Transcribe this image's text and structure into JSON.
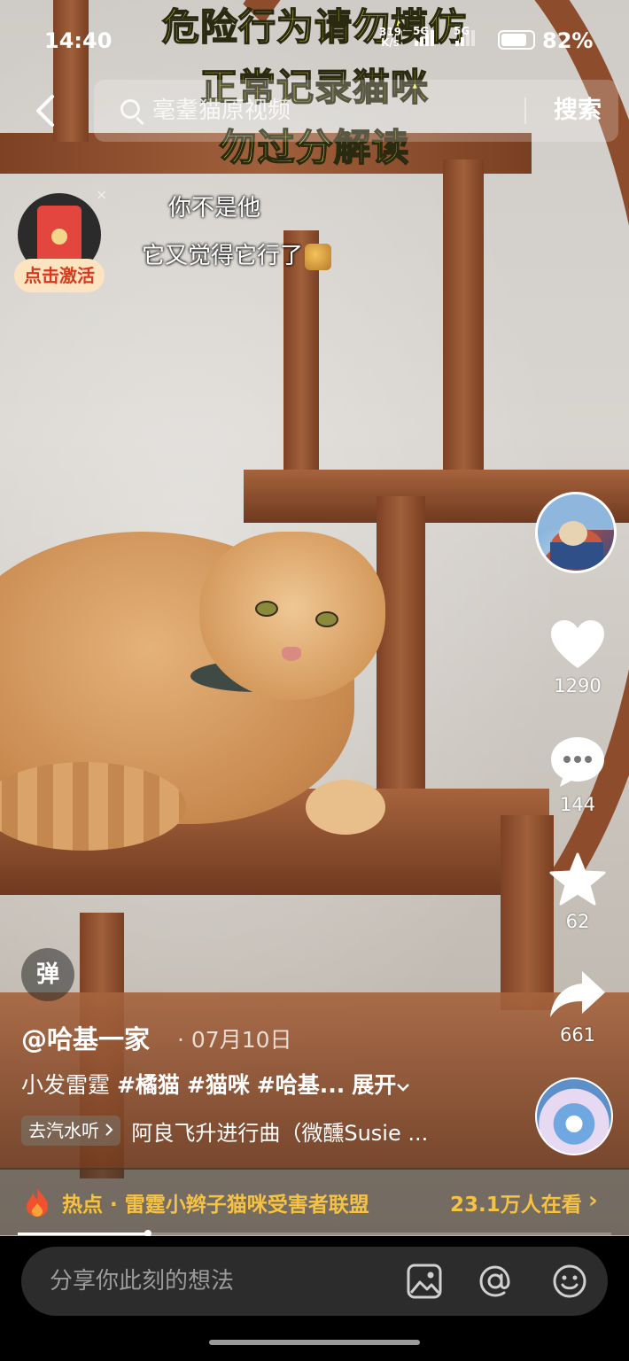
{
  "status_bar": {
    "time": "14:40",
    "net_speed": "319",
    "net_unit": "K/s",
    "signal1_label": "5G",
    "signal2_label": "5G",
    "battery": "82%"
  },
  "video": {
    "warning_lines": [
      "危险行为请勿模仿",
      "正常记录猫咪",
      "勿过分解读"
    ],
    "subtitles": [
      "你不是他",
      "它又觉得它行了"
    ]
  },
  "search": {
    "placeholder": "毫耋猫原视频",
    "button": "搜索"
  },
  "red_packet": {
    "close": "×",
    "badge": "点击激活"
  },
  "actions": {
    "likes": "1290",
    "comments": "144",
    "favorites": "62",
    "shares": "661"
  },
  "danmu_button": "弹",
  "post": {
    "author": "@哈基一家",
    "date": "· 07月10日",
    "caption_text": "小发雷霆",
    "tags": [
      "#橘猫",
      "#猫咪",
      "#哈基..."
    ],
    "expand": "展开",
    "music_chip": "去汽水听",
    "music_title": "阿良飞升进行曲（微醺Susie ..."
  },
  "hot": {
    "label": "热点 · 雷霆小辫子猫咪受害者联盟",
    "viewers": "23.1万人在看"
  },
  "playback": {
    "progress": 0.22
  },
  "comment": {
    "placeholder": "分享你此刻的想法"
  },
  "colors": {
    "warning_text": "#f3ef5a",
    "hot_text": "#f5c243",
    "red_packet_badge": "#d6391e"
  }
}
